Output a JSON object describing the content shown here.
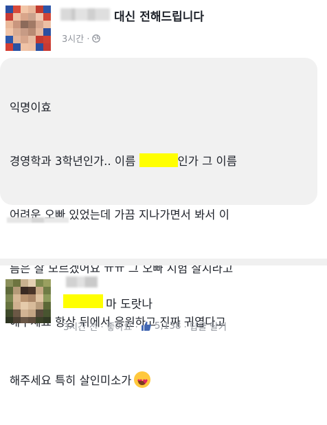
{
  "post": {
    "page_name": "대신 전해드립니다",
    "time": "3시간 ·",
    "lines": {
      "l1": "익명이효",
      "l2a": "경영학과 3학년인가.. 이름 ",
      "l2b": "인가 그 이름",
      "l3": "어려운 오빠 있었는데 가끔 지나가면서 봐서 이",
      "l4": "름은 잘 모르겠어요 ㅠㅠ 그 오빠 시험 잘치라고",
      "l5": "해주세요 항상 뒤에서 응원하고 진짜 귀엽다고",
      "l6": "해주세요 특히 살인미소가"
    }
  },
  "comment": {
    "text": "마 도랏나",
    "time": "3시간 전 · 좋아요 ·",
    "like_count": "5,138",
    "reply_label": "· 답글 달기"
  },
  "colors": {
    "highlight": "#ffff00",
    "meta_text": "#90949c",
    "facebook_blue": "#4267b2"
  },
  "icons": [
    "globe-icon",
    "thumbs-up-icon",
    "heart-eyes-emoji-icon"
  ]
}
